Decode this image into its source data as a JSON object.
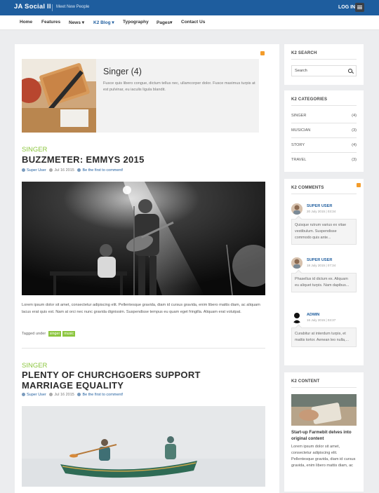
{
  "header": {
    "brand": "JA Social II",
    "tagline": "Meet New People",
    "login": "LOG IN",
    "colors": {
      "topbar": "#1e5d9e",
      "accent_green": "#8cc63f",
      "rss": "#f39c2b"
    }
  },
  "nav": {
    "items": [
      {
        "label": "Home"
      },
      {
        "label": "Features"
      },
      {
        "label": "News ▾"
      },
      {
        "label": "K2 Blog ▾"
      },
      {
        "label": "Typography"
      },
      {
        "label": "Pages▾"
      },
      {
        "label": "Contact Us"
      }
    ]
  },
  "category": {
    "title": "Singer (4)",
    "description": "Fusce quis libero congue, dictum tellus nec, ullamcorper dolor. Fusce maximus turpis at est pulvinar, eu iaculis ligula blandit."
  },
  "articles": [
    {
      "category": "SINGER",
      "title": "BUZZMETER: EMMYS 2015",
      "author": "Super User",
      "date": "Jul 16 2015",
      "comment_link": "Be the first to comment!",
      "body": "Lorem ipsum dolor sit amet, consectetur adipiscing elit. Pellentesque gravida, diam id cursus gravida, enim libero mattis diam, ac aliquam lacus erat quis est. Nam at orci nec nunc gravida dignissim. Suspendisse tempus eu quam eget fringilla. Aliquam erat volutpat.",
      "tagged_label": "Tagged under",
      "tags": [
        "singer",
        "music"
      ]
    },
    {
      "category": "SINGER",
      "title": "PLENTY OF CHURCHGOERS SUPPORT MARRIAGE EQUALITY",
      "author": "Super User",
      "date": "Jul 16 2015",
      "comment_link": "Be the first to comment!"
    }
  ],
  "sidebar": {
    "search": {
      "title": "K2 SEARCH",
      "placeholder": "Search"
    },
    "categories": {
      "title": "K2 CATEGORIES",
      "items": [
        {
          "name": "SINGER",
          "count": "(4)"
        },
        {
          "name": "MUSICIAN",
          "count": "(3)"
        },
        {
          "name": "STORY",
          "count": "(4)"
        },
        {
          "name": "TRAVEL",
          "count": "(3)"
        }
      ]
    },
    "comments": {
      "title": "K2 COMMENTS",
      "items": [
        {
          "user": "SUPER USER",
          "date": "20 July 2015 | 03:34",
          "text": "Quisque rutrum varius ex vitae vestibulum. Suspendisse commodo quis ante..."
        },
        {
          "user": "SUPER USER",
          "date": "18 July 2015 | 07:34",
          "text": "Phasellus id dictum ex. Aliquam eu aliquet turpis. Nam dapibus..."
        },
        {
          "user": "ADMIN",
          "date": "16 July 2015 | 03:37",
          "text": "Curabitur at interdum turpis, et mattis tortor. Aenean leo nulla,..."
        }
      ]
    },
    "content": {
      "title": "K2 CONTENT",
      "item_title": "Start-up Farmebit delves into original content",
      "item_body": "Lorem ipsum dolor sit amet, consectetur adipiscing elit. Pellentesque gravida, diam id cursus gravida, enim libero mattis diam, ac"
    }
  }
}
